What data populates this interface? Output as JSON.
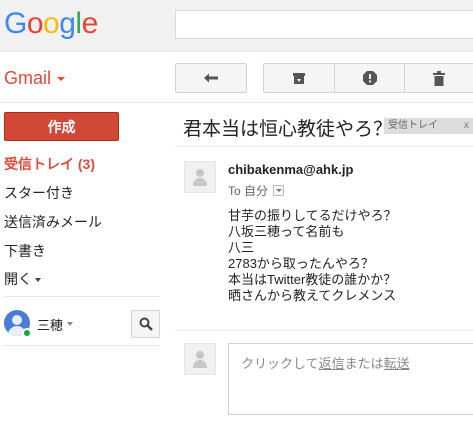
{
  "header": {
    "logo_letters": [
      {
        "char": "G",
        "color": "#4285f4"
      },
      {
        "char": "o",
        "color": "#ea4335"
      },
      {
        "char": "o",
        "color": "#fbbc05"
      },
      {
        "char": "g",
        "color": "#4285f4"
      },
      {
        "char": "l",
        "color": "#34a853"
      },
      {
        "char": "e",
        "color": "#ea4335"
      }
    ],
    "search_value": ""
  },
  "app_switcher": {
    "label": "Gmail"
  },
  "toolbar": {
    "reply_icon": "reply-icon",
    "archive_icon": "archive-icon",
    "spam_icon": "report-spam-icon",
    "delete_icon": "delete-icon"
  },
  "sidebar": {
    "compose_label": "作成",
    "items": [
      {
        "label": "受信トレイ (3)"
      },
      {
        "label": "スター付き"
      },
      {
        "label": "送信済みメール"
      },
      {
        "label": "下書き"
      },
      {
        "label": "開く"
      }
    ],
    "user_name": "三穂"
  },
  "message": {
    "subject": "君本当は恒心教徒やろ？",
    "label_chip": "受信トレイ",
    "label_close": "x",
    "sender": "chibakenma@ahk.jp",
    "to_prefix": "To",
    "to_value": "自分",
    "body_lines": [
      "甘芋の振りしてるだけやろ？",
      "八坂三穂って名前も",
      "八三",
      "2783から取ったんやろ？",
      "本当はTwitter教徒の誰かか？",
      "晒さんから教えてクレメンス"
    ]
  },
  "reply": {
    "prefix": "クリックして",
    "reply_link": "返信",
    "middle": "または",
    "forward_link": "転送"
  },
  "colors": {
    "accent_red": "#dd4b39",
    "compose_bg": "#d14836"
  }
}
